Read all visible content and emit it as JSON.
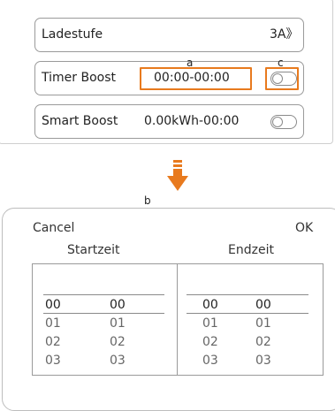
{
  "top": {
    "rows": [
      {
        "label": "Ladestufe",
        "value": "3A》"
      },
      {
        "label": "Timer Boost",
        "value": "00:00-00:00",
        "toggle_on": false
      },
      {
        "label": "Smart Boost",
        "value": "0.00kWh-00:00",
        "toggle_on": false
      }
    ],
    "markers": {
      "a": "a",
      "c": "c"
    }
  },
  "marker_b": "b",
  "accent_color": "#e87a1e",
  "icons": {
    "arrow": "down-arrow-icon"
  },
  "dialog": {
    "cancel": "Cancel",
    "ok": "OK",
    "start_label": "Startzeit",
    "end_label": "Endzeit",
    "start": {
      "hours": [
        "00",
        "01",
        "02",
        "03"
      ],
      "minutes": [
        "00",
        "01",
        "02",
        "03"
      ]
    },
    "end": {
      "hours": [
        "00",
        "01",
        "02",
        "03"
      ],
      "minutes": [
        "00",
        "01",
        "02",
        "03"
      ]
    }
  }
}
